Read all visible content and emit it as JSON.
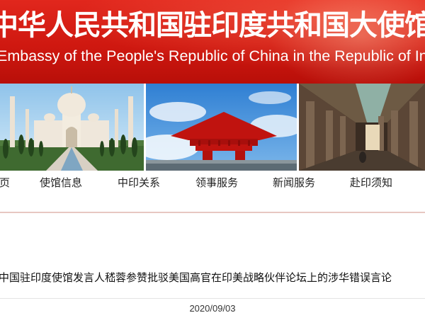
{
  "banner": {
    "title_cn": "中华人民共和国驻印度共和国大使馆",
    "title_en": "Embassy of the People's Republic of China in the Republic of India"
  },
  "nav": {
    "items": [
      {
        "label": "首页"
      },
      {
        "label": "使馆信息"
      },
      {
        "label": "中印关系"
      },
      {
        "label": "领事服务"
      },
      {
        "label": "新闻服务"
      },
      {
        "label": "赴印须知"
      }
    ]
  },
  "article": {
    "headline": "中国驻印度使馆发言人嵇蓉参赞批驳美国高官在印美战略伙伴论坛上的涉华错误言论",
    "date": "2020/09/03"
  },
  "colors": {
    "banner_red": "#d21b12",
    "nav_divider": "#e7c7c2"
  }
}
